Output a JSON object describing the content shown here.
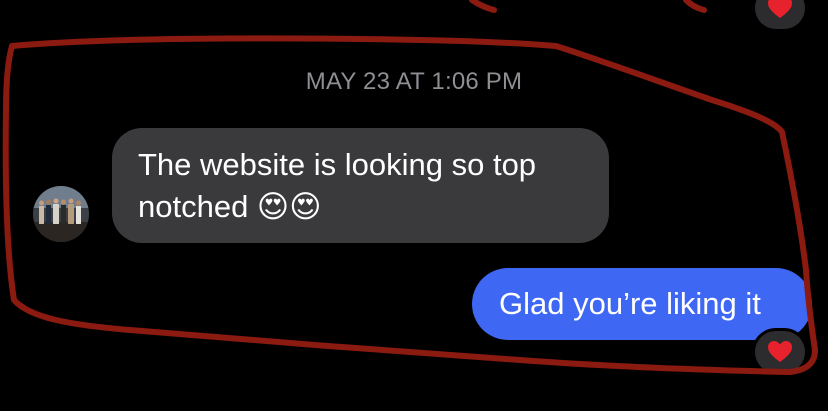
{
  "conversation": {
    "timestamp": "MAY 23 AT 1:06 PM",
    "incoming_message": {
      "text": "The website is looking so top\nnotched 😍😍",
      "bubble_color": "#3a3a3c"
    },
    "outgoing_message": {
      "text": "Glad you’re liking it",
      "bubble_color": "#3e67f4",
      "reaction": "heart-icon"
    },
    "previous_message_reaction": "heart-icon"
  },
  "colors": {
    "background": "#000000",
    "timestamp": "#8e8e93",
    "annotation_outline": "#8b1a10",
    "reaction_heart": "#e8222d"
  }
}
